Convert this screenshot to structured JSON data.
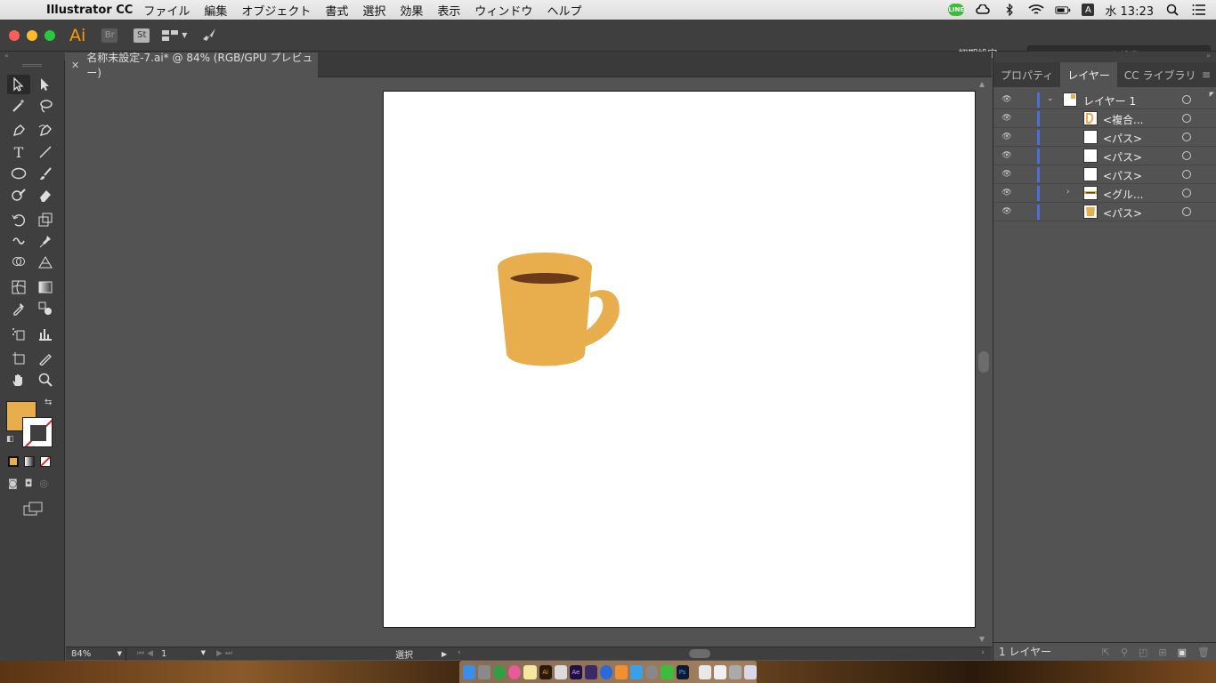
{
  "menubar": {
    "app_name": "Illustrator CC",
    "items": [
      "ファイル",
      "編集",
      "オブジェクト",
      "書式",
      "選択",
      "効果",
      "表示",
      "ウィンドウ",
      "ヘルプ"
    ],
    "line_badge": "LINE",
    "input_method": "A",
    "clock": "水 13:23"
  },
  "appbar": {
    "app_icon_text": "Ai",
    "bridge_label": "Br",
    "stock_label": "St",
    "workspace_label": "初期設定",
    "search_placeholder": "Adobe Stock を検索"
  },
  "document": {
    "tab_title": "名称未設定-7.ai* @ 84% (RGB/GPU プレビュー)"
  },
  "colors": {
    "fill": "#e8ad4c",
    "coffee": "#6b3a1a",
    "layer_bar": "#4a6fe0"
  },
  "artwork": {
    "subject": "coffee mug"
  },
  "statusbar": {
    "zoom": "84%",
    "artboard_number": "1",
    "status_tool": "選択"
  },
  "panels": {
    "tabs": [
      "プロパティ",
      "レイヤー",
      "CC ライブラリ"
    ],
    "active_tab": "レイヤー",
    "layers": [
      {
        "name": "レイヤー 1",
        "level": 0,
        "expanded": true,
        "thumb": "layer"
      },
      {
        "name": "<複合...",
        "level": 1,
        "thumb": "compound"
      },
      {
        "name": "<パス>",
        "level": 1,
        "thumb": "white"
      },
      {
        "name": "<パス>",
        "level": 1,
        "thumb": "white"
      },
      {
        "name": "<パス>",
        "level": 1,
        "thumb": "white"
      },
      {
        "name": "<グル...",
        "level": 1,
        "collapsed": true,
        "thumb": "group"
      },
      {
        "name": "<パス>",
        "level": 1,
        "thumb": "mug"
      }
    ],
    "layer_count": "1 レイヤー"
  }
}
